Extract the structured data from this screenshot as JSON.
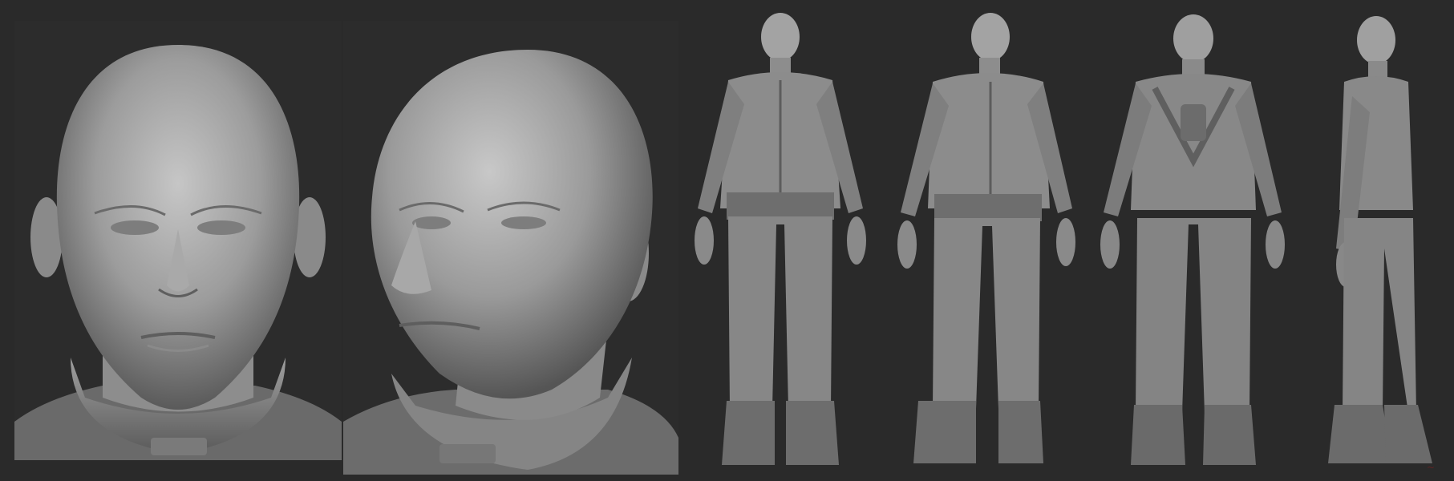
{
  "image": {
    "subject": "",
    "views": [],
    "colors": {
      "background": "#2b2b2b",
      "background_light": "#333333",
      "clay_light": "#b8b8b8",
      "clay_mid": "#8f8f8f",
      "clay_dark": "#5e5e5e",
      "clay_shadow": "#3e3e3e",
      "signature": "#7a2020"
    }
  }
}
